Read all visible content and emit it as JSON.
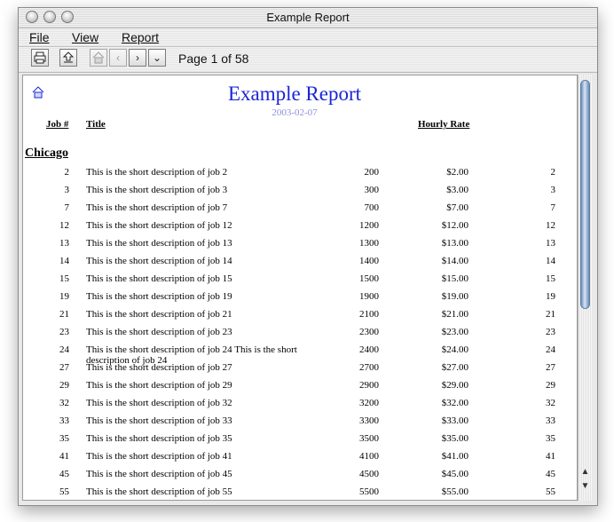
{
  "window": {
    "title": "Example Report"
  },
  "menu": {
    "file": "File",
    "view": "View",
    "report": "Report"
  },
  "toolbar": {
    "page_label": "Page 1 of 58"
  },
  "report": {
    "title": "Example Report",
    "date": "2003-02-07",
    "headers": {
      "job": "Job #",
      "title": "Title",
      "hourly_rate": "Hourly Rate"
    },
    "group": "Chicago",
    "rows": [
      {
        "job": "2",
        "title": "This is the short description of job 2",
        "qty": "200",
        "rate": "$2.00",
        "num": "2"
      },
      {
        "job": "3",
        "title": "This is the short description of job 3",
        "qty": "300",
        "rate": "$3.00",
        "num": "3"
      },
      {
        "job": "7",
        "title": "This is the short description of job 7",
        "qty": "700",
        "rate": "$7.00",
        "num": "7"
      },
      {
        "job": "12",
        "title": "This is the short description of job 12",
        "qty": "1200",
        "rate": "$12.00",
        "num": "12"
      },
      {
        "job": "13",
        "title": "This is the short description of job 13",
        "qty": "1300",
        "rate": "$13.00",
        "num": "13"
      },
      {
        "job": "14",
        "title": "This is the short description of job 14",
        "qty": "1400",
        "rate": "$14.00",
        "num": "14"
      },
      {
        "job": "15",
        "title": "This is the short description of job 15",
        "qty": "1500",
        "rate": "$15.00",
        "num": "15"
      },
      {
        "job": "19",
        "title": "This is the short description of job 19",
        "qty": "1900",
        "rate": "$19.00",
        "num": "19"
      },
      {
        "job": "21",
        "title": "This is the short description of job 21",
        "qty": "2100",
        "rate": "$21.00",
        "num": "21"
      },
      {
        "job": "23",
        "title": "This is the short description of job 23",
        "qty": "2300",
        "rate": "$23.00",
        "num": "23"
      },
      {
        "job": "24",
        "title": "This is the short description of job 24 This is the short description of job 24",
        "qty": "2400",
        "rate": "$24.00",
        "num": "24"
      },
      {
        "job": "27",
        "title": "This is the short description of job 27",
        "qty": "2700",
        "rate": "$27.00",
        "num": "27"
      },
      {
        "job": "29",
        "title": "This is the short description of job 29",
        "qty": "2900",
        "rate": "$29.00",
        "num": "29"
      },
      {
        "job": "32",
        "title": "This is the short description of job 32",
        "qty": "3200",
        "rate": "$32.00",
        "num": "32"
      },
      {
        "job": "33",
        "title": "This is the short description of job 33",
        "qty": "3300",
        "rate": "$33.00",
        "num": "33"
      },
      {
        "job": "35",
        "title": "This is the short description of job 35",
        "qty": "3500",
        "rate": "$35.00",
        "num": "35"
      },
      {
        "job": "41",
        "title": "This is the short description of job 41",
        "qty": "4100",
        "rate": "$41.00",
        "num": "41"
      },
      {
        "job": "45",
        "title": "This is the short description of job 45",
        "qty": "4500",
        "rate": "$45.00",
        "num": "45"
      },
      {
        "job": "55",
        "title": "This is the short description of job 55",
        "qty": "5500",
        "rate": "$55.00",
        "num": "55"
      }
    ]
  }
}
